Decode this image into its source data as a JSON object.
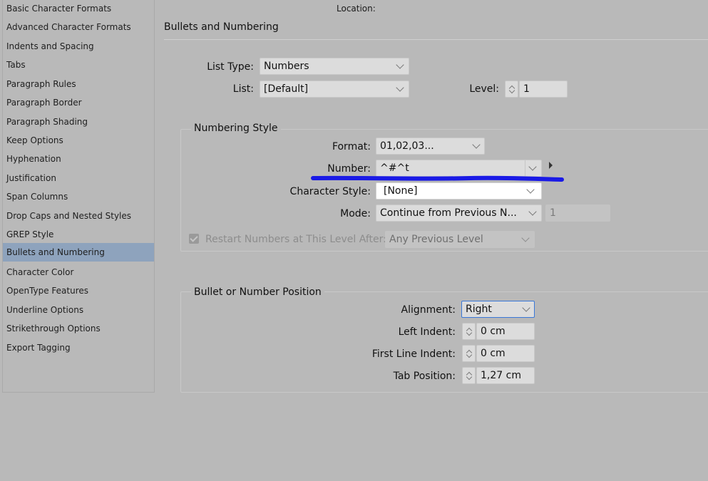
{
  "sidebar": {
    "items": [
      {
        "label": "Basic Character Formats"
      },
      {
        "label": "Advanced Character Formats"
      },
      {
        "label": "Indents and Spacing"
      },
      {
        "label": "Tabs"
      },
      {
        "label": "Paragraph Rules"
      },
      {
        "label": "Paragraph Border"
      },
      {
        "label": "Paragraph Shading"
      },
      {
        "label": "Keep Options"
      },
      {
        "label": "Hyphenation"
      },
      {
        "label": "Justification"
      },
      {
        "label": "Span Columns"
      },
      {
        "label": "Drop Caps and Nested Styles"
      },
      {
        "label": "GREP Style"
      },
      {
        "label": "Bullets and Numbering"
      },
      {
        "label": "Character Color"
      },
      {
        "label": "OpenType Features"
      },
      {
        "label": "Underline Options"
      },
      {
        "label": "Strikethrough Options"
      },
      {
        "label": "Export Tagging"
      }
    ],
    "selected": "Bullets and Numbering"
  },
  "header": {
    "location_label": "Location:",
    "section_title": "Bullets and Numbering"
  },
  "list": {
    "list_type_label": "List Type:",
    "list_type_value": "Numbers",
    "list_label": "List:",
    "list_value": "[Default]",
    "level_label": "Level:",
    "level_value": "1"
  },
  "numbering_style": {
    "title": "Numbering Style",
    "format_label": "Format:",
    "format_value": "01,02,03...",
    "number_label": "Number:",
    "number_value": "^#^t",
    "char_style_label": "Character Style:",
    "char_style_value": "[None]",
    "mode_label": "Mode:",
    "mode_value": "Continue from Previous N...",
    "mode_number": "1",
    "restart_label": "Restart Numbers at This Level After:",
    "restart_checked": true,
    "restart_value": "Any Previous Level"
  },
  "position": {
    "title": "Bullet or Number Position",
    "alignment_label": "Alignment:",
    "alignment_value": "Right",
    "left_indent_label": "Left Indent:",
    "left_indent_value": "0 cm",
    "first_line_label": "First Line Indent:",
    "first_line_value": "0 cm",
    "tab_position_label": "Tab Position:",
    "tab_position_value": "1,27 cm"
  },
  "annotation": {
    "stroke_color": "#1a1ae6"
  }
}
